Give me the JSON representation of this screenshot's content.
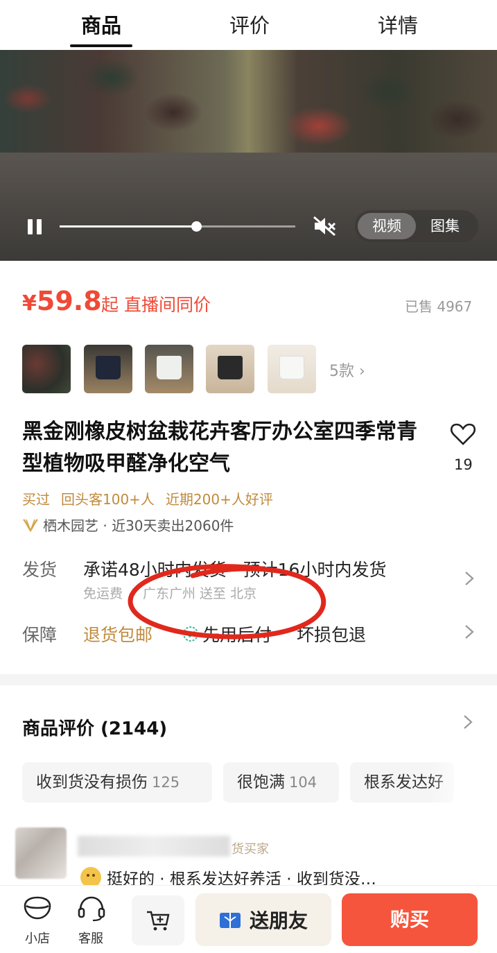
{
  "tabs": [
    {
      "label": "商品",
      "active": true
    },
    {
      "label": "评价",
      "active": false
    },
    {
      "label": "详情",
      "active": false
    }
  ],
  "video": {
    "progress": 0.58,
    "toggle_video": "视频",
    "toggle_gallery": "图集",
    "muted": true
  },
  "price": {
    "currency": "¥",
    "amount": "59.8",
    "tag": "起 直播间同价",
    "sold": "已售 4967"
  },
  "variants": {
    "more": "5款 ›"
  },
  "product": {
    "title": "黑金刚橡皮树盆栽花卉客厅办公室四季常青型植物吸甲醛净化空气",
    "fav_count": "19",
    "tags": [
      "买过",
      "回头客100+人",
      "近期200+人好评"
    ],
    "shop": "栖木园艺 · 近30天卖出2060件"
  },
  "shipping": {
    "label": "发货",
    "main": "承诺48小时内发货 · 预计16小时内发货",
    "fee": "免运费",
    "route": "广东广州 送至 北京"
  },
  "guarantee": {
    "label": "保障",
    "item1": "退货包邮",
    "item2": "先用后付",
    "item3": "坏损包退"
  },
  "reviews": {
    "title": "商品评价 (2144)",
    "chips": [
      {
        "label": "收到货没有损伤",
        "count": "125"
      },
      {
        "label": "很饱满",
        "count": "104"
      },
      {
        "label": "根系发达好",
        "count": ""
      }
    ],
    "reviewer_badge": "货买家",
    "snippet": "挺好的 · 根系发达好养活 · 收到货没…"
  },
  "bottom": {
    "shop": "小店",
    "service": "客服",
    "gift": "送朋友",
    "buy": "购买"
  },
  "colors": {
    "accent": "#ef4a36",
    "gold": "#c08a3c",
    "buy": "#f5553c"
  }
}
